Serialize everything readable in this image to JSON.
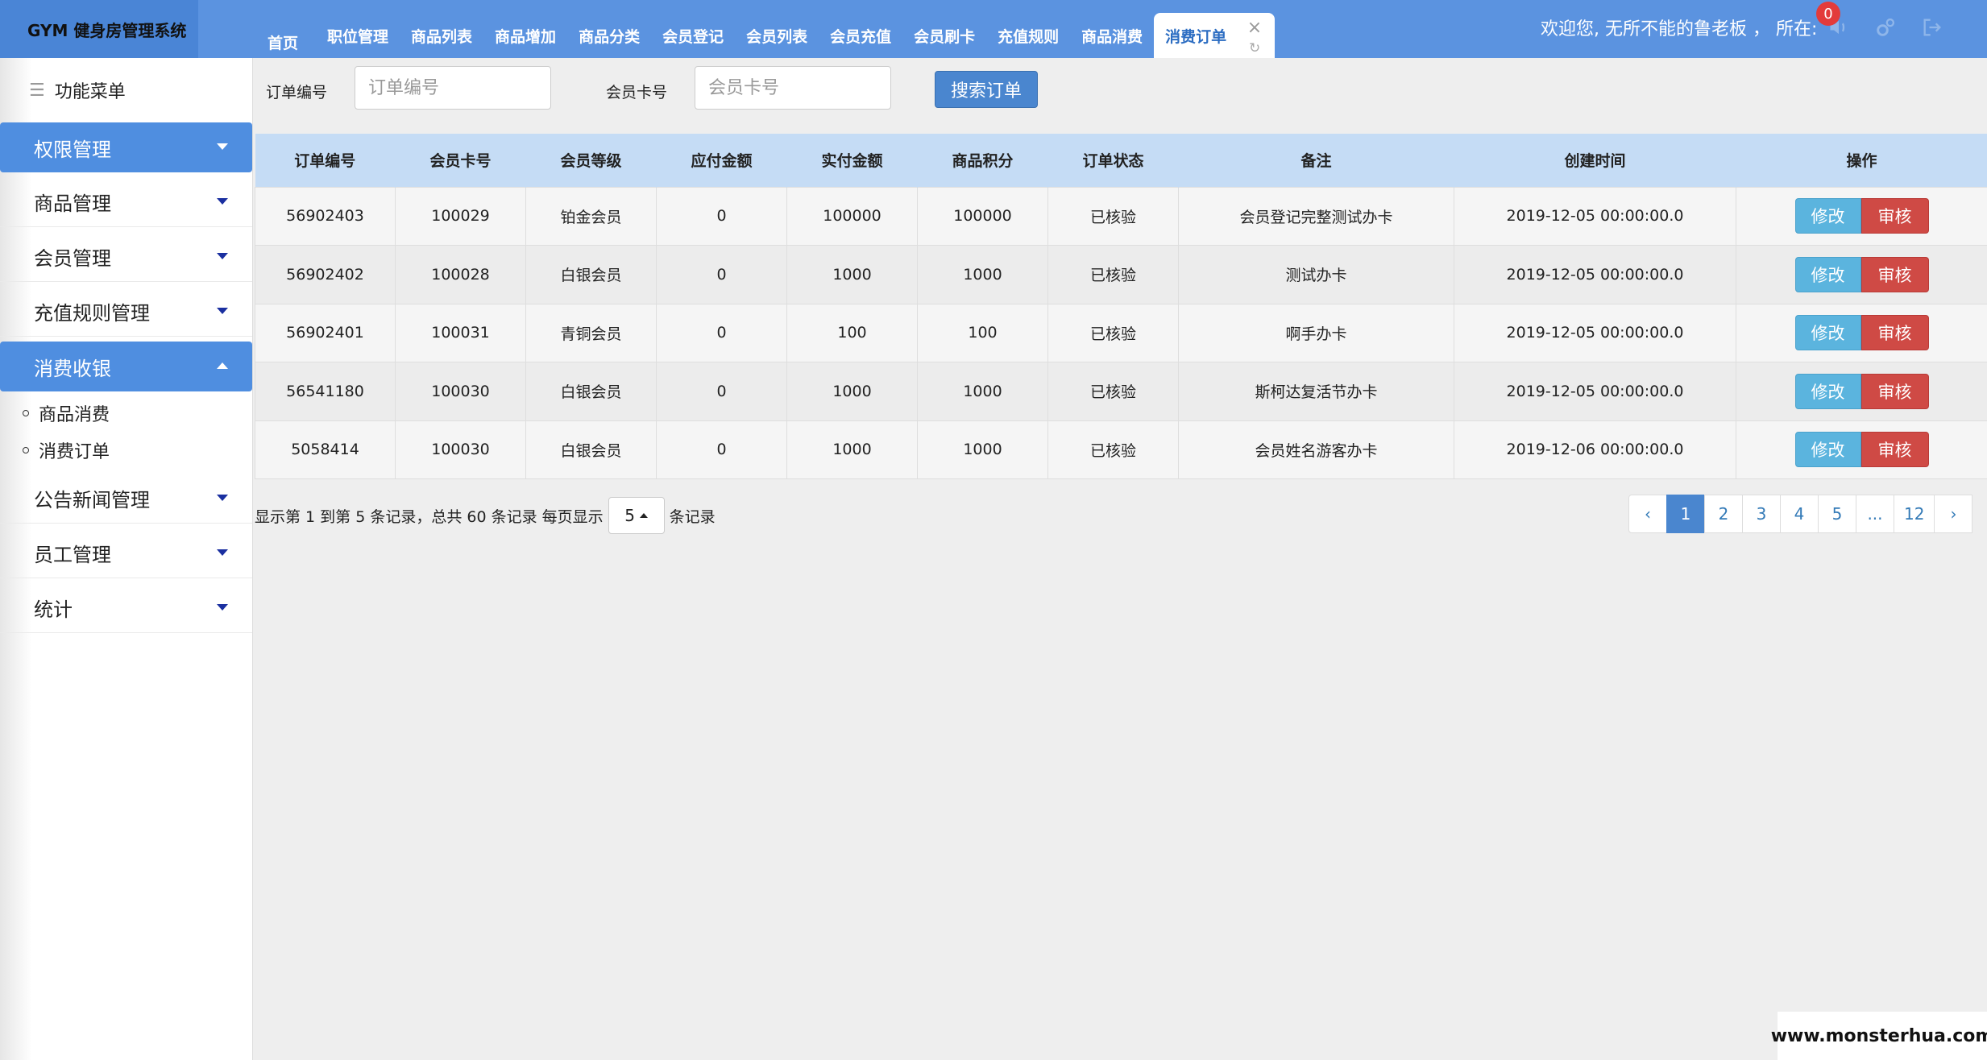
{
  "app": {
    "title": "GYM 健身房管理系统"
  },
  "tabs": [
    {
      "label": "首页"
    },
    {
      "label": "职位管理"
    },
    {
      "label": "商品列表"
    },
    {
      "label": "商品增加"
    },
    {
      "label": "商品分类"
    },
    {
      "label": "会员登记"
    },
    {
      "label": "会员列表"
    },
    {
      "label": "会员充值"
    },
    {
      "label": "会员刷卡"
    },
    {
      "label": "充值规则"
    },
    {
      "label": "商品消费"
    },
    {
      "label": "消费订单"
    }
  ],
  "tab_close_icon": "×",
  "tab_refresh_icon": "↻",
  "header": {
    "welcome": "欢迎您, 无所不能的鲁老板 ， 所在:",
    "notification_count": "0",
    "icons": [
      "speaker-icon",
      "settings-icon",
      "logout-icon"
    ]
  },
  "sidebar": {
    "title": "功能菜单",
    "items": [
      {
        "label": "权限管理"
      },
      {
        "label": "商品管理"
      },
      {
        "label": "会员管理"
      },
      {
        "label": "充值规则管理"
      },
      {
        "label": "消费收银"
      },
      {
        "label": "公告新闻管理"
      },
      {
        "label": "员工管理"
      },
      {
        "label": "统计"
      }
    ],
    "sub_items": [
      {
        "label": "商品消费"
      },
      {
        "label": "消费订单"
      }
    ]
  },
  "search": {
    "order_label": "订单编号",
    "order_placeholder": "订单编号",
    "card_label": "会员卡号",
    "card_placeholder": "会员卡号",
    "button": "搜索订单"
  },
  "table": {
    "headers": [
      "订单编号",
      "会员卡号",
      "会员等级",
      "应付金额",
      "实付金额",
      "商品积分",
      "订单状态",
      "备注",
      "创建时间",
      "操作"
    ],
    "rows": [
      [
        "56902403",
        "100029",
        "铂金会员",
        "0",
        "100000",
        "100000",
        "已核验",
        "会员登记完整测试办卡",
        "2019-12-05 00:00:00.0"
      ],
      [
        "56902402",
        "100028",
        "白银会员",
        "0",
        "1000",
        "1000",
        "已核验",
        "测试办卡",
        "2019-12-05 00:00:00.0"
      ],
      [
        "56902401",
        "100031",
        "青铜会员",
        "0",
        "100",
        "100",
        "已核验",
        "啊手办卡",
        "2019-12-05 00:00:00.0"
      ],
      [
        "56541180",
        "100030",
        "白银会员",
        "0",
        "1000",
        "1000",
        "已核验",
        "斯柯达复活节办卡",
        "2019-12-05 00:00:00.0"
      ],
      [
        "5058414",
        "100030",
        "白银会员",
        "0",
        "1000",
        "1000",
        "已核验",
        "会员姓名游客办卡",
        "2019-12-06 00:00:00.0"
      ]
    ],
    "edit_label": "修改",
    "audit_label": "审核"
  },
  "pagination": {
    "info_prefix": "显示第 1 到第 5 条记录，总共 60 条记录  每页显示",
    "page_size": "5",
    "info_suffix": "条记录",
    "prev": "‹",
    "pages": [
      "1",
      "2",
      "3",
      "4",
      "5",
      "...",
      "12"
    ],
    "next": "›",
    "current": "1"
  },
  "watermark": "www.monsterhua.com"
}
